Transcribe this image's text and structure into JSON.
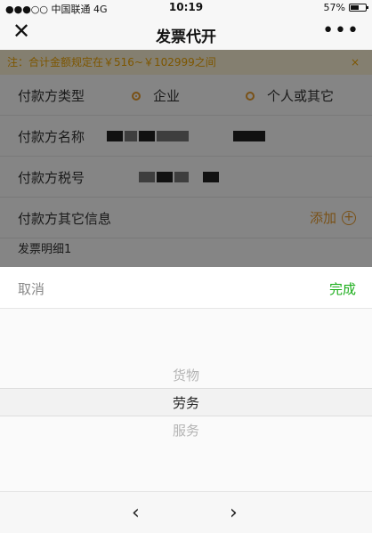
{
  "status": {
    "signal": "●●●○○",
    "carrier": "中国联通",
    "network": "4G",
    "time": "10:19",
    "battery": "57%",
    "battery_level": 0.57
  },
  "nav": {
    "close_icon": "close-icon",
    "title": "发票代开",
    "more_icon": "more-icon",
    "more_text": "•••"
  },
  "notice": {
    "text": "注：合计金额规定在￥516~￥102999之间",
    "close": "×"
  },
  "form": {
    "payer_type_label": "付款方类型",
    "option_company": "企业",
    "option_personal": "个人或其它",
    "payer_name_label": "付款方名称",
    "payer_tax_label": "付款方税号",
    "other_info_label": "付款方其它信息",
    "add_label": "添加",
    "invoice_detail_label": "发票明细1"
  },
  "picker": {
    "cancel": "取消",
    "done": "完成",
    "options": [
      "货物",
      "劳务",
      "服务"
    ],
    "selected": "劳务",
    "prev": "‹",
    "next": "›"
  },
  "colors": {
    "accent": "#e89b2c",
    "done_green": "#1aad19",
    "notice_bg": "#fdf3d7"
  }
}
